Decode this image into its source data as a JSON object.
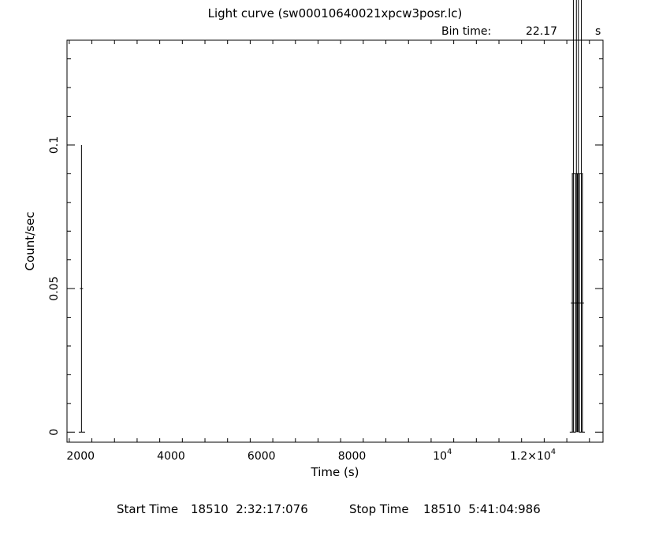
{
  "chart_data": {
    "type": "line",
    "title": "Light curve (sw00010640021xpcw3posr.lc)",
    "bin_time_label": "Bin time:",
    "bin_time_value": "22.17",
    "bin_time_unit": "s",
    "xlabel": "Time (s)",
    "ylabel": "Count/sec",
    "xlim": [
      1700,
      13550
    ],
    "ylim": [
      -0.0035,
      0.1365
    ],
    "x_ticks": [
      {
        "value": 2000,
        "label": "2000"
      },
      {
        "value": 4000,
        "label": "4000"
      },
      {
        "value": 6000,
        "label": "6000"
      },
      {
        "value": 8000,
        "label": "8000"
      },
      {
        "value": 10000,
        "label": "10",
        "exp": "4"
      },
      {
        "value": 12000,
        "label": "1.2×10",
        "exp": "4"
      }
    ],
    "y_ticks": [
      {
        "value": 0,
        "label": "0"
      },
      {
        "value": 0.05,
        "label": "0.05"
      },
      {
        "value": 0.1,
        "label": "0.1"
      }
    ],
    "series": [
      {
        "points": [
          {
            "x": 1995,
            "y": 0.0,
            "err": 0.0
          },
          {
            "x": 2020,
            "y": 0.05,
            "err": 0.05
          },
          {
            "x": 2065,
            "y": 0.0,
            "err": 0.0
          },
          {
            "x": 12850,
            "y": 0.0,
            "err": 0.0
          },
          {
            "x": 12872,
            "y": 0.045,
            "err": 0.045
          },
          {
            "x": 12895,
            "y": 0.09,
            "err": 0.09
          },
          {
            "x": 12917,
            "y": 0.0,
            "err": 0.0
          },
          {
            "x": 12940,
            "y": 0.045,
            "err": 0.045
          },
          {
            "x": 12962,
            "y": 0.09,
            "err": 0.09
          },
          {
            "x": 12984,
            "y": 0.045,
            "err": 0.045
          },
          {
            "x": 13006,
            "y": 0.09,
            "err": 0.09
          },
          {
            "x": 13028,
            "y": 0.045,
            "err": 0.045
          },
          {
            "x": 13050,
            "y": 0.0,
            "err": 0.0
          },
          {
            "x": 13072,
            "y": 0.09,
            "err": 0.09
          },
          {
            "x": 13094,
            "y": 0.045,
            "err": 0.045
          },
          {
            "x": 13116,
            "y": 0.0,
            "err": 0.0
          }
        ]
      }
    ]
  },
  "footer": {
    "start_label": "Start Time",
    "start_value": "18510  2:32:17:076",
    "stop_label": "Stop Time",
    "stop_value": "18510  5:41:04:986"
  }
}
